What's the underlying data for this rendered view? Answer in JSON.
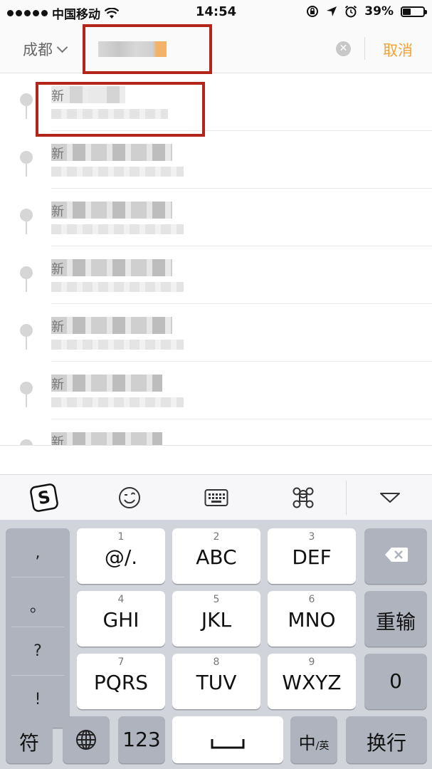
{
  "status": {
    "carrier": "中国移动",
    "time": "14:54",
    "battery": "39%",
    "battery_level": 0.39
  },
  "header": {
    "city": "成都",
    "search_value": "",
    "cancel_label": "取消"
  },
  "results": [
    {
      "title": "新"
    },
    {
      "title": "新"
    },
    {
      "title": "新"
    },
    {
      "title": "新"
    },
    {
      "title": "新"
    },
    {
      "title": "新"
    },
    {
      "title": "新"
    }
  ],
  "ime_bar": {
    "icons": [
      "sogou-logo-icon",
      "emoji-icon",
      "keyboard-icon",
      "command-icon",
      "hide-keyboard-icon"
    ]
  },
  "keyboard": {
    "punctuation": [
      ",",
      "。",
      "?",
      "!"
    ],
    "rows": [
      [
        {
          "num": "1",
          "label": "@/."
        },
        {
          "num": "2",
          "label": "ABC"
        },
        {
          "num": "3",
          "label": "DEF"
        }
      ],
      [
        {
          "num": "4",
          "label": "GHI"
        },
        {
          "num": "5",
          "label": "JKL"
        },
        {
          "num": "6",
          "label": "MNO"
        }
      ],
      [
        {
          "num": "7",
          "label": "PQRS"
        },
        {
          "num": "8",
          "label": "TUV"
        },
        {
          "num": "9",
          "label": "WXYZ"
        }
      ]
    ],
    "reinput": "重输",
    "zero": "0",
    "symbol": "符",
    "digits": "123",
    "space": "␣",
    "lang_main": "中",
    "lang_sub": "/英",
    "enter": "换行"
  }
}
